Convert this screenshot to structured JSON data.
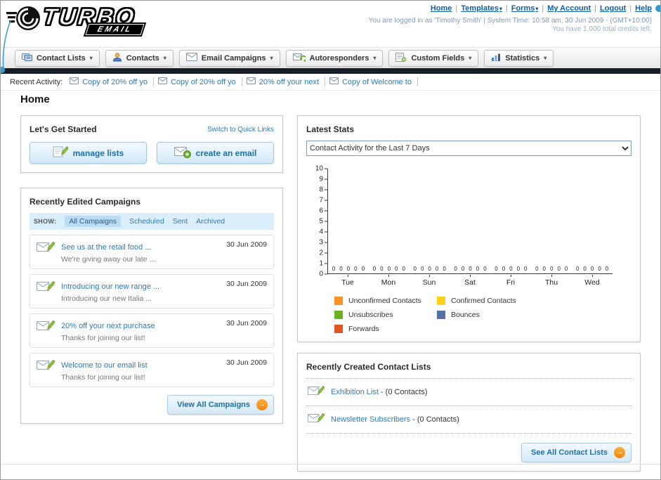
{
  "logo": {
    "title": "TURBO",
    "subtitle": "EMAIL"
  },
  "header": {
    "sep": "|",
    "nav": [
      {
        "label": "Home"
      },
      {
        "label": "Templates"
      },
      {
        "label": "Forms"
      },
      {
        "label": "My Account"
      },
      {
        "label": "Logout"
      },
      {
        "label": "Help"
      }
    ],
    "login_info": "You are logged in as 'Timothy Smith' | System Time: 10:58 am, 30 Jun 2009 - (GMT+10:00)",
    "credits_info": "You have 1,000 total credits left."
  },
  "tabs": [
    {
      "label": "Contact Lists"
    },
    {
      "label": "Contacts"
    },
    {
      "label": "Email Campaigns"
    },
    {
      "label": "Autoresponders"
    },
    {
      "label": "Custom Fields"
    },
    {
      "label": "Statistics"
    }
  ],
  "activity": {
    "label": "Recent Activity:",
    "items": [
      {
        "label": "Copy of 20% off yo"
      },
      {
        "label": "Copy of 20% off yo"
      },
      {
        "label": "20% off your next"
      },
      {
        "label": "Copy of Welcome to"
      }
    ]
  },
  "page": {
    "title": "Home"
  },
  "get_started": {
    "title": "Let's Get Started",
    "switch_link": "Switch to Quick Links",
    "manage_lists_label": "manage lists",
    "create_email_label": "create an email"
  },
  "campaigns": {
    "title": "Recently Edited Campaigns",
    "show_label": "SHOW:",
    "filters": [
      {
        "label": "All Campaigns"
      },
      {
        "label": "Scheduled"
      },
      {
        "label": "Sent"
      },
      {
        "label": "Archived"
      }
    ],
    "items": [
      {
        "title": "See us at the retail food ...",
        "subtitle": "We're giving away our late ...",
        "date": "30 Jun 2009"
      },
      {
        "title": "Introducing our new range ...",
        "subtitle": "Introducing our new Italia ...",
        "date": "30 Jun 2009"
      },
      {
        "title": "20% off your next purchase",
        "subtitle": "Thanks for joining our list!",
        "date": "30 Jun 2009"
      },
      {
        "title": "Welcome to our email list",
        "subtitle": "Thanks for joining our list!",
        "date": "30 Jun 2009"
      }
    ],
    "view_all_label": "View All Campaigns"
  },
  "stats": {
    "title": "Latest Stats",
    "selected_option": "Contact Activity for the Last 7 Days"
  },
  "chart_data": {
    "type": "bar",
    "title": "Contact Activity for the Last 7 Days",
    "categories": [
      "Tue",
      "Mon",
      "Sun",
      "Sat",
      "Fri",
      "Thu",
      "Wed"
    ],
    "series": [
      {
        "name": "Unconfirmed Contacts",
        "color": "#f79327",
        "values": [
          0,
          0,
          0,
          0,
          0,
          0,
          0
        ]
      },
      {
        "name": "Confirmed Contacts",
        "color": "#fdd01e",
        "values": [
          0,
          0,
          0,
          0,
          0,
          0,
          0
        ]
      },
      {
        "name": "Unsubscribes",
        "color": "#6cb024",
        "values": [
          0,
          0,
          0,
          0,
          0,
          0,
          0
        ]
      },
      {
        "name": "Bounces",
        "color": "#5572a7",
        "values": [
          0,
          0,
          0,
          0,
          0,
          0,
          0
        ]
      },
      {
        "name": "Forwards",
        "color": "#e25522",
        "values": [
          0,
          0,
          0,
          0,
          0,
          0,
          0
        ]
      }
    ],
    "ylim": [
      0,
      10
    ],
    "ytick_step": 1,
    "grid": false,
    "legend_position": "bottom"
  },
  "contact_lists": {
    "title": "Recently Created Contact Lists",
    "items": [
      {
        "name": "Exhibition List",
        "suffix": " - (0 Contacts)"
      },
      {
        "name": "Newsletter Subscribers",
        "suffix": " - (0 Contacts)"
      }
    ],
    "see_all_label": "See All Contact Lists"
  }
}
